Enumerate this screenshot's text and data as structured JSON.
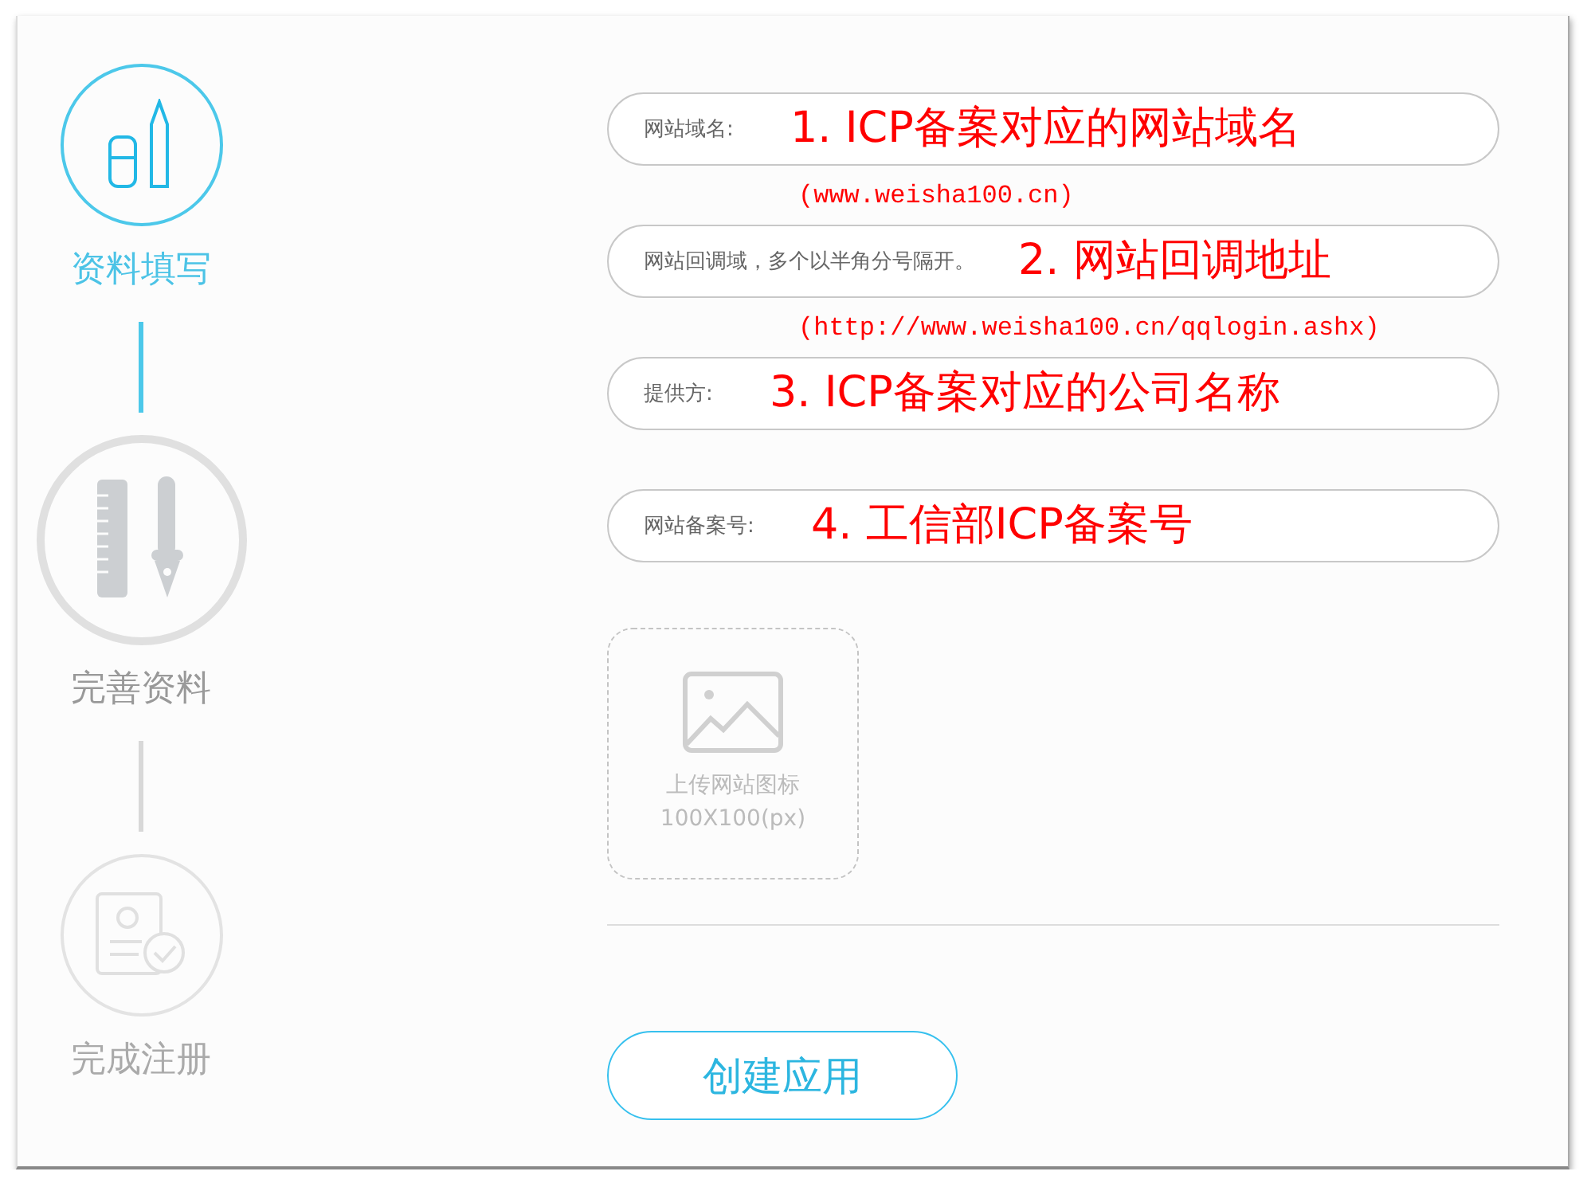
{
  "steps": [
    {
      "label": "资料填写",
      "kind": "edit",
      "completed": true,
      "current": false
    },
    {
      "label": "完善资料",
      "kind": "tools",
      "completed": false,
      "current": true
    },
    {
      "label": "完成注册",
      "kind": "done",
      "completed": false,
      "current": false
    }
  ],
  "fields": [
    {
      "placeholder": "网站域名:",
      "annotation": "1. ICP备案对应的网站域名",
      "hint": "(www.weisha100.cn)"
    },
    {
      "placeholder": "网站回调域，多个以半角分号隔开。",
      "annotation": "2. 网站回调地址",
      "hint": "(http://www.weisha100.cn/qqlogin.ashx)"
    },
    {
      "placeholder": "提供方:",
      "annotation": "3. ICP备案对应的公司名称"
    },
    {
      "placeholder": "网站备案号:",
      "annotation": "4. 工信部ICP备案号"
    }
  ],
  "upload": {
    "label": "上传网站图标",
    "size": "100X100(px)"
  },
  "submit": "创建应用"
}
